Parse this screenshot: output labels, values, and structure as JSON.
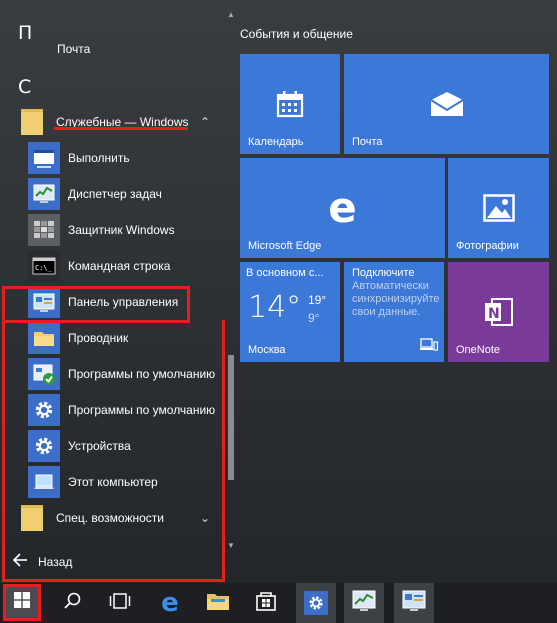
{
  "app_list": {
    "letter_p": "П",
    "partial_item": "Почта",
    "letter_c": "С",
    "folder": {
      "label": "Служебные — Windows",
      "chevron": "^"
    },
    "subitems": [
      {
        "label": "Выполнить",
        "icon": "run-icon"
      },
      {
        "label": "Диспетчер задач",
        "icon": "task-manager-icon"
      },
      {
        "label": "Защитник Windows",
        "icon": "windows-defender-icon"
      },
      {
        "label": "Командная строка",
        "icon": "command-prompt-icon"
      },
      {
        "label": "Панель управления",
        "icon": "control-panel-icon"
      },
      {
        "label": "Проводник",
        "icon": "file-explorer-icon"
      },
      {
        "label": "Программы по умолчанию",
        "icon": "default-programs-icon"
      },
      {
        "label": "Программы по умолчанию",
        "icon": "gear-icon"
      },
      {
        "label": "Устройства",
        "icon": "gear-icon"
      },
      {
        "label": "Этот компьютер",
        "icon": "computer-icon"
      }
    ],
    "accessibility": {
      "label": "Спец. возможности",
      "chevron": "v"
    },
    "back_label": "Назад"
  },
  "tiles": {
    "heading": "События и общение",
    "calendar": "Календарь",
    "mail": "Почта",
    "edge": "Microsoft Edge",
    "photos": "Фотографии",
    "weather": {
      "condition": "В основном с...",
      "temp": "14°",
      "high": "19°",
      "low": "9°",
      "city": "Москва"
    },
    "sync": {
      "line1": "Подключите",
      "rest": "Автоматически синхронизируйте свои данные."
    },
    "onenote": "OneNote"
  },
  "taskbar": {
    "icons": [
      "windows-start-icon",
      "search-icon",
      "task-view-icon",
      "edge-icon",
      "file-explorer-icon",
      "store-icon",
      "settings-icon",
      "task-manager-icon",
      "control-panel-icon"
    ]
  },
  "colors": {
    "tile_blue": "#3c78d8",
    "onenote_purple": "#7a3a9a",
    "highlight_red": "#e31f1f"
  }
}
